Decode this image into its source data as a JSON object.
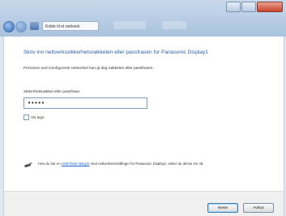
{
  "window": {
    "address_text": "Koble til et nettverk"
  },
  "page": {
    "heading": "Skriv inn nettverkssikkerhetsnøkkelen eller passfrasen for Panasonic Display1",
    "description": "Personen som konfigurerte nettverket kan gi deg nøkkelen eller passfrasen.",
    "field_label": "Sikkerhetsnøkkel eller passfrase:",
    "password_value": "•••••",
    "show_chars_label": "Vis tegn"
  },
  "wps": {
    "text_before": "Hvis du har en",
    "link_text": "USB-flash-stasjon",
    "text_after": "med nettverksinnstillinger for Panasonic Display1, setter du denne inn nå."
  },
  "buttons": {
    "next": "Neste",
    "cancel": "Avbryt"
  }
}
